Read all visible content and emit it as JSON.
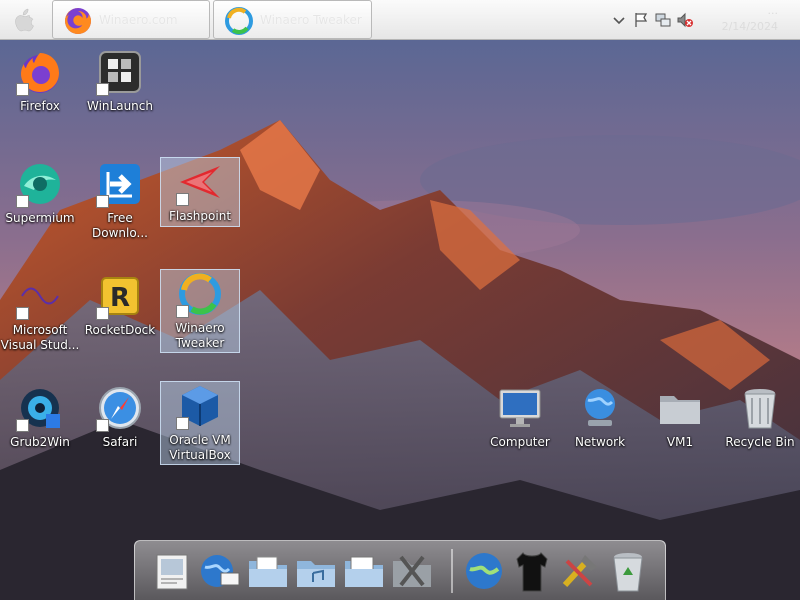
{
  "taskbar": {
    "apple_icon": "apple-logo-icon",
    "tasks": [
      {
        "label": "Winaero.com",
        "icon": "firefox-icon"
      },
      {
        "label": "Winaero Tweaker",
        "icon": "winaero-tweaker-icon"
      }
    ],
    "tray": {
      "icons": [
        "chevron-down-icon",
        "flag-icon",
        "network-icon",
        "volume-muted-icon"
      ],
      "time": "...",
      "date": "2/14/2024"
    }
  },
  "desktop": {
    "icons": [
      {
        "label": "Firefox",
        "icon": "firefox-icon"
      },
      {
        "label": "WinLaunch",
        "icon": "winlaunch-icon"
      },
      {
        "label": "Supermium",
        "icon": "supermium-icon"
      },
      {
        "label": "Free Downlo...",
        "icon": "free-download-manager-icon"
      },
      {
        "label": "Flashpoint",
        "icon": "flashpoint-icon"
      },
      {
        "label": "Microsoft Visual Stud...",
        "icon": "visual-studio-icon"
      },
      {
        "label": "RocketDock",
        "icon": "rocketdock-icon"
      },
      {
        "label": "Winaero Tweaker",
        "icon": "winaero-tweaker-icon"
      },
      {
        "label": "Grub2Win",
        "icon": "grub2win-icon"
      },
      {
        "label": "Safari",
        "icon": "safari-icon"
      },
      {
        "label": "Oracle VM VirtualBox",
        "icon": "virtualbox-icon"
      },
      {
        "label": "Computer",
        "icon": "computer-icon"
      },
      {
        "label": "Network",
        "icon": "network-globe-icon"
      },
      {
        "label": "VM1",
        "icon": "folder-icon"
      },
      {
        "label": "Recycle Bin",
        "icon": "recycle-bin-icon"
      }
    ]
  },
  "dock": {
    "items": [
      "preview-icon",
      "globe-mail-icon",
      "documents-folder-icon",
      "music-folder-icon",
      "pictures-folder-icon",
      "utilities-icon",
      "network-globe-icon",
      "tshirt-icon",
      "tools-icon",
      "recycle-bin-icon"
    ]
  }
}
